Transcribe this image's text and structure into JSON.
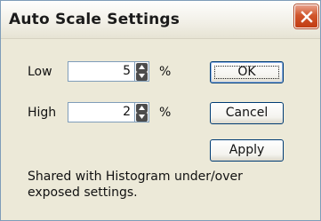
{
  "window": {
    "title": "Auto Scale Settings",
    "close_icon": "close-icon"
  },
  "fields": {
    "low": {
      "label": "Low",
      "value": "5",
      "unit": "%"
    },
    "high": {
      "label": "High",
      "value": "2",
      "unit": "%"
    }
  },
  "buttons": {
    "ok": "OK",
    "cancel": "Cancel",
    "apply": "Apply"
  },
  "note": "Shared with Histogram under/over exposed settings.",
  "colors": {
    "dialog_bg": "#ece9d8",
    "close_button": "#c94a22",
    "input_border": "#7f9db9",
    "button_border": "#003c74"
  }
}
